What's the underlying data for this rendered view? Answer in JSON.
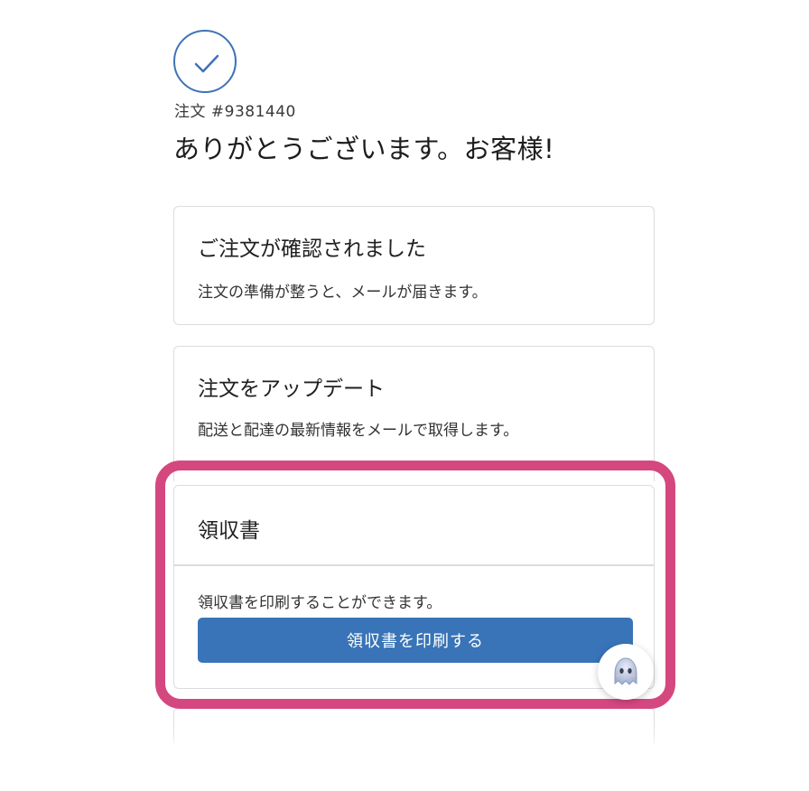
{
  "order": {
    "number_label": "注文 #9381440",
    "thanks_heading": "ありがとうございます。お客様!"
  },
  "cards": {
    "confirmed": {
      "title": "ご注文が確認されました",
      "description": "注文の準備が整うと、メールが届きます。"
    },
    "updates": {
      "title": "注文をアップデート",
      "description": "配送と配達の最新情報をメールで取得します。"
    },
    "receipt": {
      "title": "領収書",
      "description": "領収書を印刷することができます。",
      "button_label": "領収書を印刷する"
    }
  },
  "icons": {
    "status": "checkmark-circle-icon",
    "chat": "chat-assistant-icon"
  },
  "colors": {
    "accent": "#3874b7",
    "highlight": "#d5477f",
    "check": "#3f73b6"
  }
}
